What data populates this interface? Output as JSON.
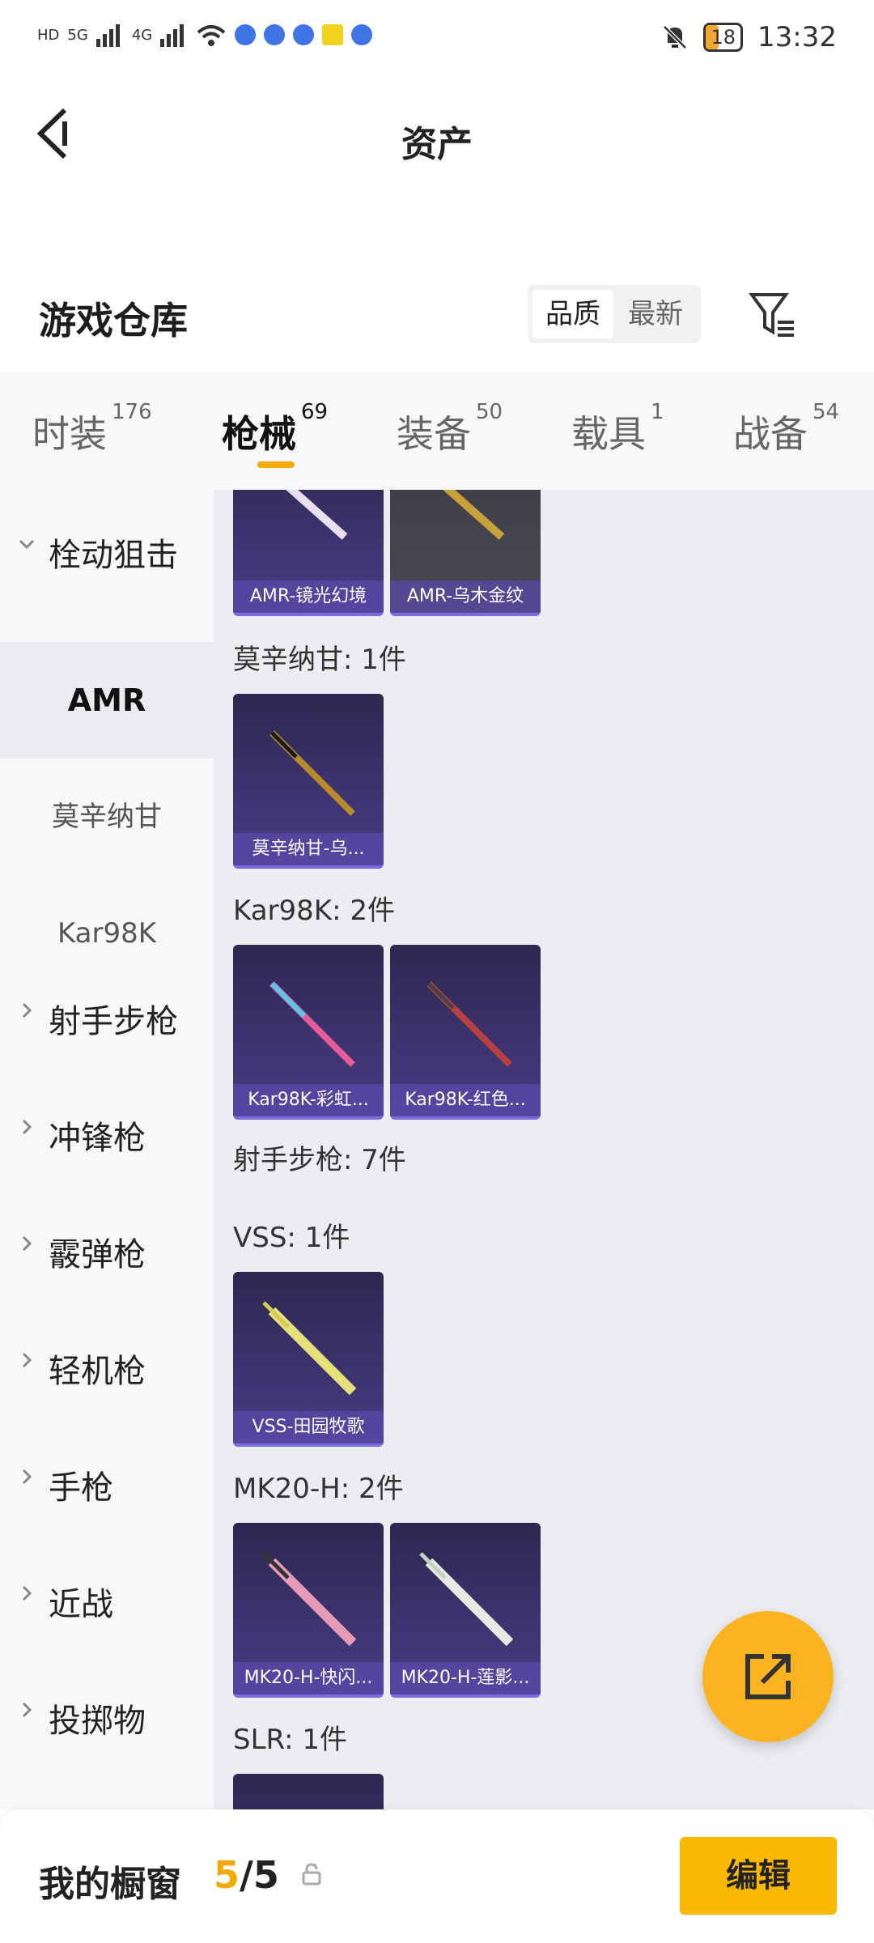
{
  "status_bar": {
    "time": "13:32",
    "battery": "18",
    "signal_labels": [
      "HD",
      "5G",
      "4G"
    ]
  },
  "header": {
    "title": "资产"
  },
  "warehouse": {
    "title": "游戏仓库",
    "sort_options": [
      "品质",
      "最新"
    ]
  },
  "tabs": [
    {
      "label": "时装",
      "count": "176"
    },
    {
      "label": "枪械",
      "count": "69",
      "active": true
    },
    {
      "label": "装备",
      "count": "50"
    },
    {
      "label": "载具",
      "count": "1"
    },
    {
      "label": "战备",
      "count": "54"
    }
  ],
  "sidebar": {
    "group1": "栓动狙击",
    "sub1": "AMR",
    "sub2": "莫辛纳甘",
    "sub3": "Kar98K",
    "group2": "射手步枪",
    "group3": "冲锋枪",
    "group4": "霰弹枪",
    "group5": "轻机枪",
    "group6": "手枪",
    "group7": "近战",
    "group8": "投掷物"
  },
  "content": {
    "amr_items": [
      "AMR-镜光幻境",
      "AMR-乌木金纹"
    ],
    "mosin_header": "莫辛纳甘: 1件",
    "mosin_items": [
      "莫辛纳甘-乌..."
    ],
    "kar_header": "Kar98K: 2件",
    "kar_items": [
      "Kar98K-彩虹...",
      "Kar98K-红色..."
    ],
    "dmr_header": "射手步枪: 7件",
    "vss_header": "VSS: 1件",
    "vss_items": [
      "VSS-田园牧歌"
    ],
    "mk20_header": "MK20-H: 2件",
    "mk20_items": [
      "MK20-H-快闪...",
      "MK20-H-莲影..."
    ],
    "slr_header": "SLR: 1件"
  },
  "bottom": {
    "label": "我的橱窗",
    "current": "5",
    "total": "/5",
    "edit": "编辑"
  },
  "colors": {
    "accent": "#fbb800",
    "active_underline": "#f5a800"
  }
}
